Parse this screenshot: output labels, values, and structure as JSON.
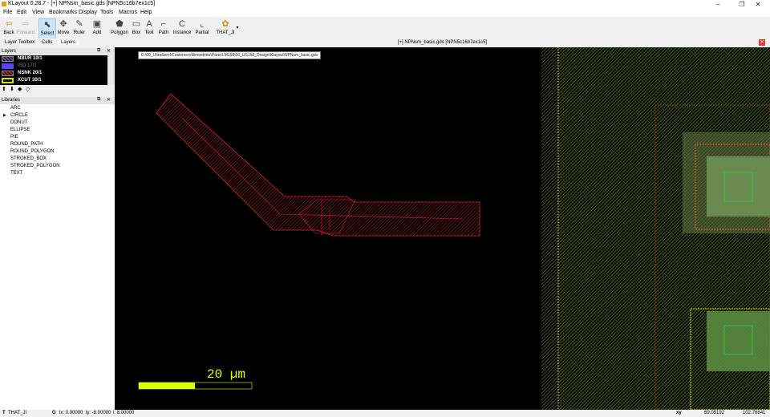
{
  "window": {
    "title": "KLayout 0.28.7 - [+] NPNsm_basic.gds [NPN5c16b7ex1c5]"
  },
  "menu": [
    "File",
    "Edit",
    "View",
    "Bookmarks",
    "Display",
    "Tools",
    "Macros",
    "Help"
  ],
  "toolbar": {
    "back": "Back",
    "forward": "Forward",
    "select": "Select",
    "move": "Move",
    "ruler": "Ruler",
    "add": "Add",
    "polygon": "Polygon",
    "box": "Box",
    "text": "Text",
    "path": "Path",
    "instance": "Instance",
    "partial": "Partial",
    "macro": "THAT_JI"
  },
  "left_tabs": [
    "Layer Toolbox",
    "Cells",
    "Layers"
  ],
  "layers_panel": {
    "title": "Layers",
    "items": [
      {
        "name": "NBUR 10/1",
        "color": "#8060a0"
      },
      {
        "name": "ISO 17/1",
        "color": "#6040ff"
      },
      {
        "name": "NSNK 20/1",
        "color": "#c03040"
      },
      {
        "name": "XCUT 30/1",
        "color": "#e0e000"
      }
    ]
  },
  "libraries_panel": {
    "title": "Libraries",
    "items": [
      "ARC",
      "CIRCLE",
      "DONUT",
      "ELLIPSE",
      "PIE",
      "ROUND_PATH",
      "ROUND_POLYGON",
      "STROKED_BOX",
      "STROKED_POLYGON",
      "TEXT"
    ]
  },
  "document": {
    "tab_title": "[+] NPNsm_basic.gds [NPN5c16b7ex1c5]",
    "tooltip": "D:\\00_UltraSemi\\Customers\\Benedetto\\Parts\\LM158\\00_US158_Design\\Klayout\\NPNsm_basic.gds",
    "scale_label": "20 µm"
  },
  "status": {
    "macro": "THAT_JI",
    "grid": "G",
    "lx": "lx: 0.00000",
    "ly": "ly: -8.00000",
    "l": "l: 8.00000",
    "mode": "xy",
    "x": "69.05192",
    "y": "102.76841"
  }
}
